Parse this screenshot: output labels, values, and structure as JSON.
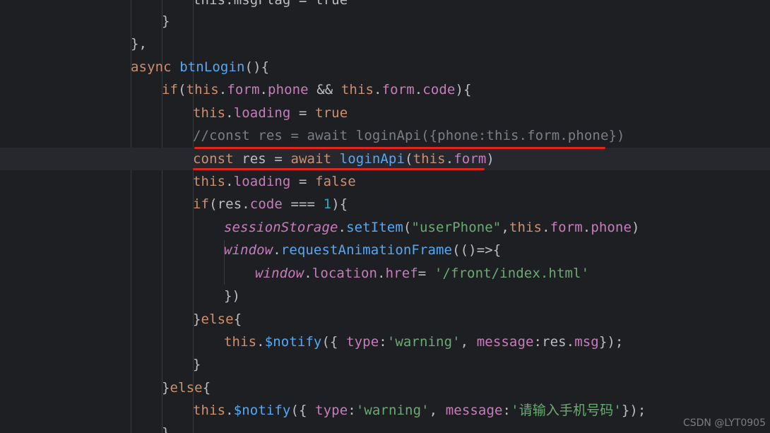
{
  "lines": [
    {
      "tokens": [
        {
          "t": "this.msgFlag = true",
          "c": "pl"
        }
      ]
    },
    {
      "tokens": [
        {
          "t": "}",
          "c": "pl"
        }
      ]
    },
    {
      "tokens": [
        {
          "t": "},",
          "c": "pl"
        }
      ]
    },
    {
      "tokens": [
        {
          "t": "async ",
          "c": "kw"
        },
        {
          "t": "btnLogin",
          "c": "fn"
        },
        {
          "t": "(){",
          "c": "pl"
        }
      ]
    },
    {
      "tokens": [
        {
          "t": "if",
          "c": "kw"
        },
        {
          "t": "(",
          "c": "pl"
        },
        {
          "t": "this",
          "c": "kw"
        },
        {
          "t": ".",
          "c": "pl"
        },
        {
          "t": "form",
          "c": "prop"
        },
        {
          "t": ".",
          "c": "pl"
        },
        {
          "t": "phone",
          "c": "prop"
        },
        {
          "t": " && ",
          "c": "pl"
        },
        {
          "t": "this",
          "c": "kw"
        },
        {
          "t": ".",
          "c": "pl"
        },
        {
          "t": "form",
          "c": "prop"
        },
        {
          "t": ".",
          "c": "pl"
        },
        {
          "t": "code",
          "c": "prop"
        },
        {
          "t": "){",
          "c": "pl"
        }
      ]
    },
    {
      "tokens": [
        {
          "t": "this",
          "c": "kw"
        },
        {
          "t": ".",
          "c": "pl"
        },
        {
          "t": "loading",
          "c": "prop"
        },
        {
          "t": " = ",
          "c": "pl"
        },
        {
          "t": "true",
          "c": "kw"
        }
      ]
    },
    {
      "tokens": [
        {
          "t": "//const res = await loginApi({phone:this.form.phone})",
          "c": "cmt"
        }
      ]
    },
    {
      "tokens": [
        {
          "t": "const ",
          "c": "kw"
        },
        {
          "t": "res = ",
          "c": "pl"
        },
        {
          "t": "await ",
          "c": "kw"
        },
        {
          "t": "loginApi",
          "c": "fn"
        },
        {
          "t": "(",
          "c": "pl"
        },
        {
          "t": "this",
          "c": "kw"
        },
        {
          "t": ".",
          "c": "pl"
        },
        {
          "t": "form",
          "c": "prop"
        },
        {
          "t": ")",
          "c": "pl"
        }
      ]
    },
    {
      "tokens": [
        {
          "t": "this",
          "c": "kw"
        },
        {
          "t": ".",
          "c": "pl"
        },
        {
          "t": "loading",
          "c": "prop"
        },
        {
          "t": " = ",
          "c": "pl"
        },
        {
          "t": "false",
          "c": "kw"
        }
      ]
    },
    {
      "tokens": [
        {
          "t": "if",
          "c": "kw"
        },
        {
          "t": "(res.",
          "c": "pl"
        },
        {
          "t": "code",
          "c": "prop"
        },
        {
          "t": " === ",
          "c": "pl"
        },
        {
          "t": "1",
          "c": "num"
        },
        {
          "t": "){",
          "c": "pl"
        }
      ]
    },
    {
      "tokens": [
        {
          "t": "sessionStorage",
          "c": "ital"
        },
        {
          "t": ".",
          "c": "pl"
        },
        {
          "t": "setItem",
          "c": "fn"
        },
        {
          "t": "(",
          "c": "pl"
        },
        {
          "t": "\"userPhone\"",
          "c": "str"
        },
        {
          "t": ",",
          "c": "pl"
        },
        {
          "t": "this",
          "c": "kw"
        },
        {
          "t": ".",
          "c": "pl"
        },
        {
          "t": "form",
          "c": "prop"
        },
        {
          "t": ".",
          "c": "pl"
        },
        {
          "t": "phone",
          "c": "prop"
        },
        {
          "t": ")",
          "c": "pl"
        }
      ]
    },
    {
      "tokens": [
        {
          "t": "window",
          "c": "ital"
        },
        {
          "t": ".",
          "c": "pl"
        },
        {
          "t": "requestAnimationFrame",
          "c": "fn"
        },
        {
          "t": "(()=>{",
          "c": "pl"
        }
      ]
    },
    {
      "tokens": [
        {
          "t": "window",
          "c": "ital"
        },
        {
          "t": ".",
          "c": "pl"
        },
        {
          "t": "location",
          "c": "prop"
        },
        {
          "t": ".",
          "c": "pl"
        },
        {
          "t": "href",
          "c": "prop"
        },
        {
          "t": "= ",
          "c": "pl"
        },
        {
          "t": "'/front/index.html'",
          "c": "str"
        }
      ]
    },
    {
      "tokens": [
        {
          "t": "})",
          "c": "pl"
        }
      ]
    },
    {
      "tokens": [
        {
          "t": "}",
          "c": "pl"
        },
        {
          "t": "else",
          "c": "kw"
        },
        {
          "t": "{",
          "c": "pl"
        }
      ]
    },
    {
      "tokens": [
        {
          "t": "this",
          "c": "kw"
        },
        {
          "t": ".",
          "c": "pl"
        },
        {
          "t": "$notify",
          "c": "fn"
        },
        {
          "t": "({ ",
          "c": "pl"
        },
        {
          "t": "type",
          "c": "prop"
        },
        {
          "t": ":",
          "c": "pl"
        },
        {
          "t": "'warning'",
          "c": "str"
        },
        {
          "t": ", ",
          "c": "pl"
        },
        {
          "t": "message",
          "c": "prop"
        },
        {
          "t": ":res.",
          "c": "pl"
        },
        {
          "t": "msg",
          "c": "prop"
        },
        {
          "t": "});",
          "c": "pl"
        }
      ]
    },
    {
      "tokens": [
        {
          "t": "}",
          "c": "pl"
        }
      ]
    },
    {
      "tokens": [
        {
          "t": "}",
          "c": "pl"
        },
        {
          "t": "else",
          "c": "kw"
        },
        {
          "t": "{",
          "c": "pl"
        }
      ]
    },
    {
      "tokens": [
        {
          "t": "this",
          "c": "kw"
        },
        {
          "t": ".",
          "c": "pl"
        },
        {
          "t": "$notify",
          "c": "fn"
        },
        {
          "t": "({ ",
          "c": "pl"
        },
        {
          "t": "type",
          "c": "prop"
        },
        {
          "t": ":",
          "c": "pl"
        },
        {
          "t": "'warning'",
          "c": "str"
        },
        {
          "t": ", ",
          "c": "pl"
        },
        {
          "t": "message",
          "c": "prop"
        },
        {
          "t": ":",
          "c": "pl"
        },
        {
          "t": "'请输入手机号码'",
          "c": "str"
        },
        {
          "t": "});",
          "c": "pl"
        }
      ]
    },
    {
      "tokens": [
        {
          "t": "}",
          "c": "pl"
        }
      ]
    }
  ],
  "watermark": "CSDN @LYT0905"
}
